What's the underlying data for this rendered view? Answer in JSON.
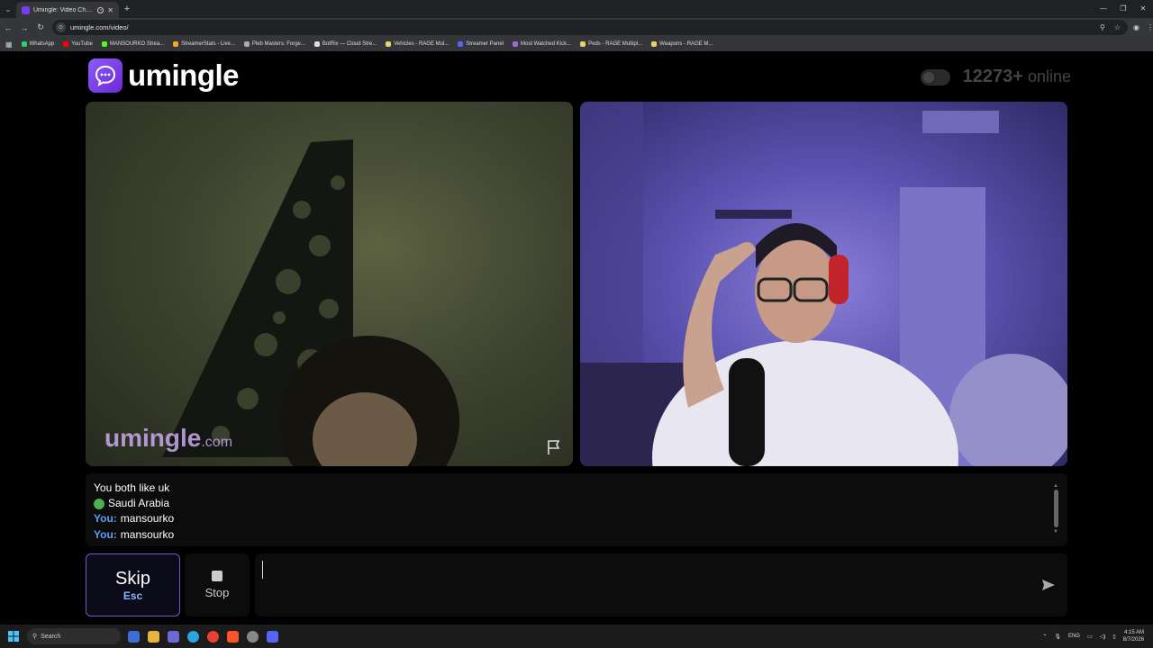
{
  "browser": {
    "tab_title": "Umingle: Video Chat with S",
    "new_tab_symbol": "+",
    "url": "umingle.com/video/",
    "bookmarks": [
      {
        "label": "WhatsApp",
        "color": "#25d366"
      },
      {
        "label": "YouTube",
        "color": "#ff0000"
      },
      {
        "label": "MANSOURKO Strea...",
        "color": "#53fc18"
      },
      {
        "label": "StreamerStats - Live...",
        "color": "#f5a623"
      },
      {
        "label": "Pleb Masters: Forge...",
        "color": "#aaaaaa"
      },
      {
        "label": "BotRix — Cloud Stre...",
        "color": "#dddddd"
      },
      {
        "label": "Vehicles - RAGE Mul...",
        "color": "#e8d36b"
      },
      {
        "label": "Streamer Panel",
        "color": "#5865f2"
      },
      {
        "label": "Most Watched Kick...",
        "color": "#9c6ade"
      },
      {
        "label": "Peds - RAGE Multipl...",
        "color": "#e8d36b"
      },
      {
        "label": "Weapons - RAGE M...",
        "color": "#e8d36b"
      }
    ]
  },
  "header": {
    "logo_text": "umingle",
    "online_count": "12273+",
    "online_label": "online"
  },
  "video": {
    "watermark_main": "umingle",
    "watermark_domain": ".com"
  },
  "chat": {
    "common_interest": "You both like uk",
    "country": "Saudi Arabia",
    "messages": [
      {
        "sender": "You:",
        "text": "mansourko"
      },
      {
        "sender": "You:",
        "text": "mansourko"
      }
    ]
  },
  "controls": {
    "skip_label": "Skip",
    "skip_key": "Esc",
    "stop_label": "Stop",
    "message_placeholder": ""
  },
  "taskbar": {
    "search_label": "Search",
    "language": "ENG",
    "time": "4:15 AM",
    "date": "8/7/2026"
  },
  "colors": {
    "accent": "#7c3aed",
    "you_label": "#5b9df5",
    "skip_border": "#6b5cc7"
  }
}
